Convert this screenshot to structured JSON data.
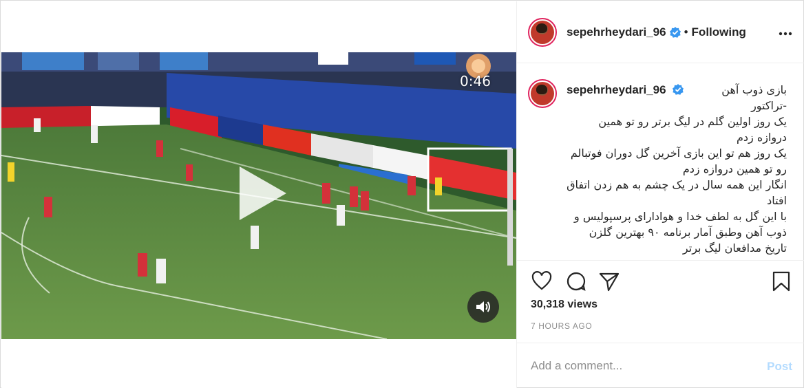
{
  "post": {
    "username": "sepehrheydari_96",
    "follow_status": "Following",
    "separator": "•",
    "more_icon": "more-horizontal-icon",
    "caption": "بازی ذوب آهن\n-تراکتور\nیک روز اولین گلم در لیگ برتر رو تو همین دروازه زدم\nیک روز هم تو این بازی آخرین گل دوران فوتبالم رو تو همین دروازه زدم\nانگار این همه سال در یک چشم به هم زدن اتفاق افتاد\nبا این گل به لطف خدا و هوادارای پرسپولیس و ذوب آهن وطبق آمار برنامه ۹۰ بهترین گلزن تاریخ مدافعان لیگ برتر",
    "views": "30,318 views",
    "timestamp": "7 HOURS AGO"
  },
  "video": {
    "timer": "0:46",
    "play_icon": "play-icon",
    "sound_icon": "speaker-icon"
  },
  "comment": {
    "placeholder": "Add a comment...",
    "post_label": "Post"
  },
  "colors": {
    "accent_disabled": "#b3dbff",
    "verified": "#3897f0",
    "muted": "#8e8e8e"
  }
}
